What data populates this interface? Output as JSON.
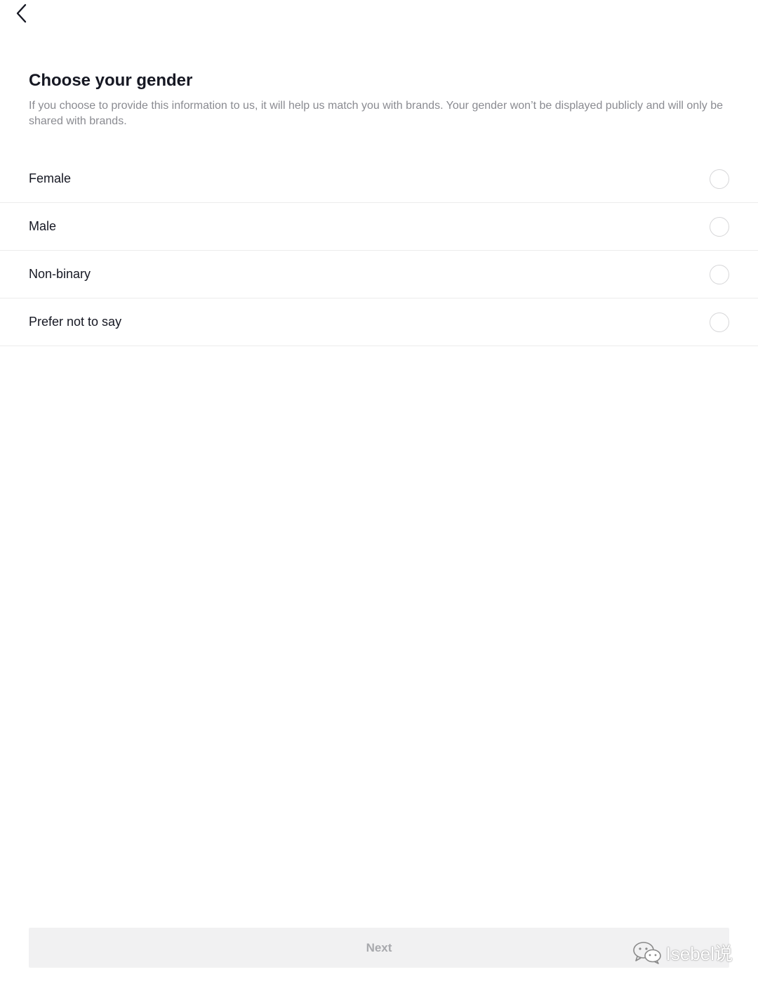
{
  "nav": {
    "back_icon": "chevron-left-icon"
  },
  "header": {
    "title": "Choose your gender",
    "subtitle": "If you choose to provide this information to us, it will help us match you with brands. Your gender won’t be displayed publicly and will only be shared with brands."
  },
  "options": [
    {
      "label": "Female",
      "selected": false
    },
    {
      "label": "Male",
      "selected": false
    },
    {
      "label": "Non-binary",
      "selected": false
    },
    {
      "label": "Prefer not to say",
      "selected": false
    }
  ],
  "footer": {
    "next_label": "Next",
    "next_enabled": false
  },
  "watermark": {
    "text": "Isebel说",
    "icon": "wechat-icon"
  },
  "colors": {
    "text_primary": "#161823",
    "text_secondary": "#8a8b91",
    "divider": "#ececec",
    "button_disabled_bg": "#f1f1f2",
    "button_disabled_text": "#a8a9ad"
  }
}
